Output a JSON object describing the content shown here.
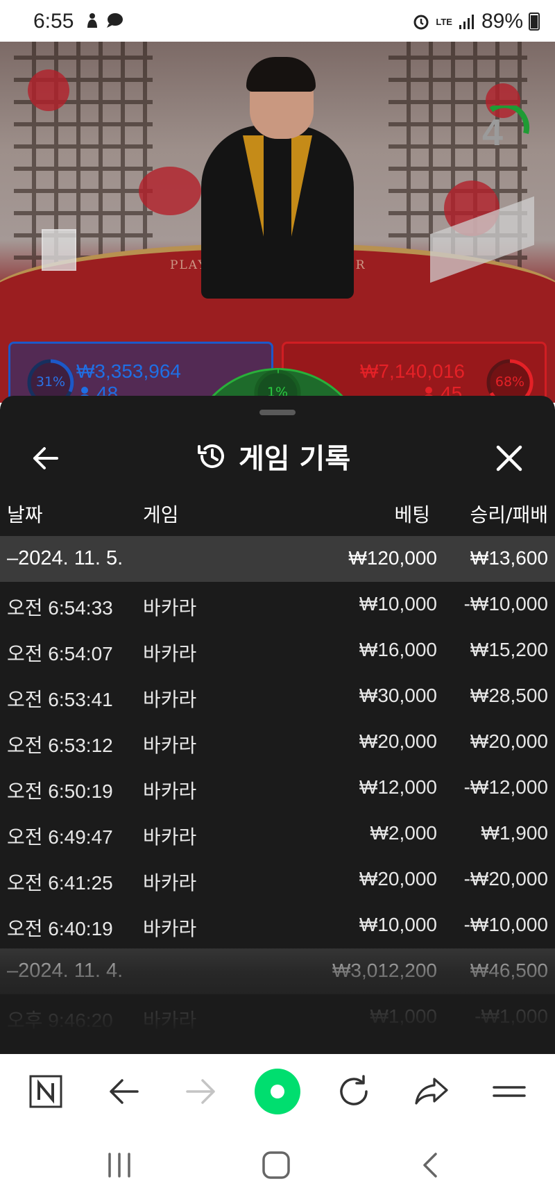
{
  "status_bar": {
    "time": "6:55",
    "battery": "89%",
    "network": "LTE"
  },
  "game_view": {
    "timer": "4",
    "table_labels": {
      "player": "PLAYER",
      "banker": "BANKER"
    },
    "player_bet": {
      "percent": "31%",
      "percent_value": 0.31,
      "amount": "₩3,353,964",
      "players": "48",
      "color": "#1d58c8"
    },
    "banker_bet": {
      "percent": "68%",
      "percent_value": 0.68,
      "amount": "₩7,140,016",
      "players": "45",
      "color": "#d01e23"
    },
    "tie_bet": {
      "percent": "1%",
      "percent_value": 0.01,
      "color": "#29b03a"
    }
  },
  "history_sheet": {
    "title": "게임 기록",
    "icons": {
      "back": "arrow-left-icon",
      "history": "history-icon",
      "close": "close-icon"
    },
    "columns": {
      "date": "날짜",
      "game": "게임",
      "bet": "베팅",
      "win_loss": "승리/패배"
    },
    "groups": [
      {
        "date": "2024. 11. 5.",
        "total_bet": "₩120,000",
        "total_win_loss": "₩13,600",
        "rows": [
          {
            "time": "오전 6:54:33",
            "game": "바카라",
            "bet": "₩10,000",
            "win_loss": "-₩10,000"
          },
          {
            "time": "오전 6:54:07",
            "game": "바카라",
            "bet": "₩16,000",
            "win_loss": "₩15,200"
          },
          {
            "time": "오전 6:53:41",
            "game": "바카라",
            "bet": "₩30,000",
            "win_loss": "₩28,500"
          },
          {
            "time": "오전 6:53:12",
            "game": "바카라",
            "bet": "₩20,000",
            "win_loss": "₩20,000"
          },
          {
            "time": "오전 6:50:19",
            "game": "바카라",
            "bet": "₩12,000",
            "win_loss": "-₩12,000"
          },
          {
            "time": "오전 6:49:47",
            "game": "바카라",
            "bet": "₩2,000",
            "win_loss": "₩1,900"
          },
          {
            "time": "오전 6:41:25",
            "game": "바카라",
            "bet": "₩20,000",
            "win_loss": "-₩20,000"
          },
          {
            "time": "오전 6:40:19",
            "game": "바카라",
            "bet": "₩10,000",
            "win_loss": "-₩10,000"
          }
        ]
      },
      {
        "date": "2024. 11. 4.",
        "total_bet": "₩3,012,200",
        "total_win_loss": "₩46,500",
        "rows": [
          {
            "time": "오후 9:46:20",
            "game": "바카라",
            "bet": "₩1,000",
            "win_loss": "-₩1,000"
          }
        ]
      }
    ]
  },
  "browser_toolbar": {
    "buttons": [
      "naver-home-icon",
      "back-arrow-icon",
      "forward-arrow-icon",
      "green-dot-icon",
      "refresh-icon",
      "share-icon",
      "menu-icon"
    ],
    "accent": "#00de6f"
  },
  "system_nav": {
    "buttons": [
      "recent-apps-icon",
      "home-icon",
      "back-icon"
    ]
  }
}
